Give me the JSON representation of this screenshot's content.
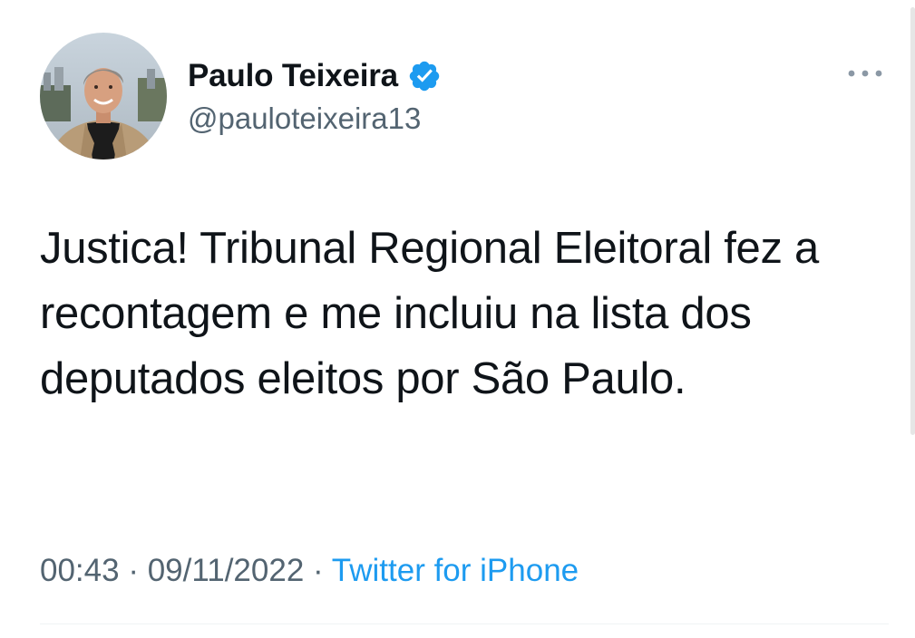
{
  "author": {
    "display_name": "Paulo Teixeira",
    "handle": "@pauloteixeira13",
    "verified": true,
    "avatar_icon": "profile-photo"
  },
  "tweet": {
    "text": "Justica! Tribunal Regional Eleitoral fez a recontagem e me incluiu na lista dos deputados eleitos por São Paulo.",
    "time": "00:43",
    "date": "09/11/2022",
    "separator": "·",
    "source": "Twitter for iPhone"
  },
  "colors": {
    "text": "#0f1419",
    "secondary": "#536471",
    "accent": "#1d9bf0",
    "background": "#ffffff"
  },
  "icons": {
    "verified": "verified-badge-icon",
    "more": "more-options-icon"
  }
}
